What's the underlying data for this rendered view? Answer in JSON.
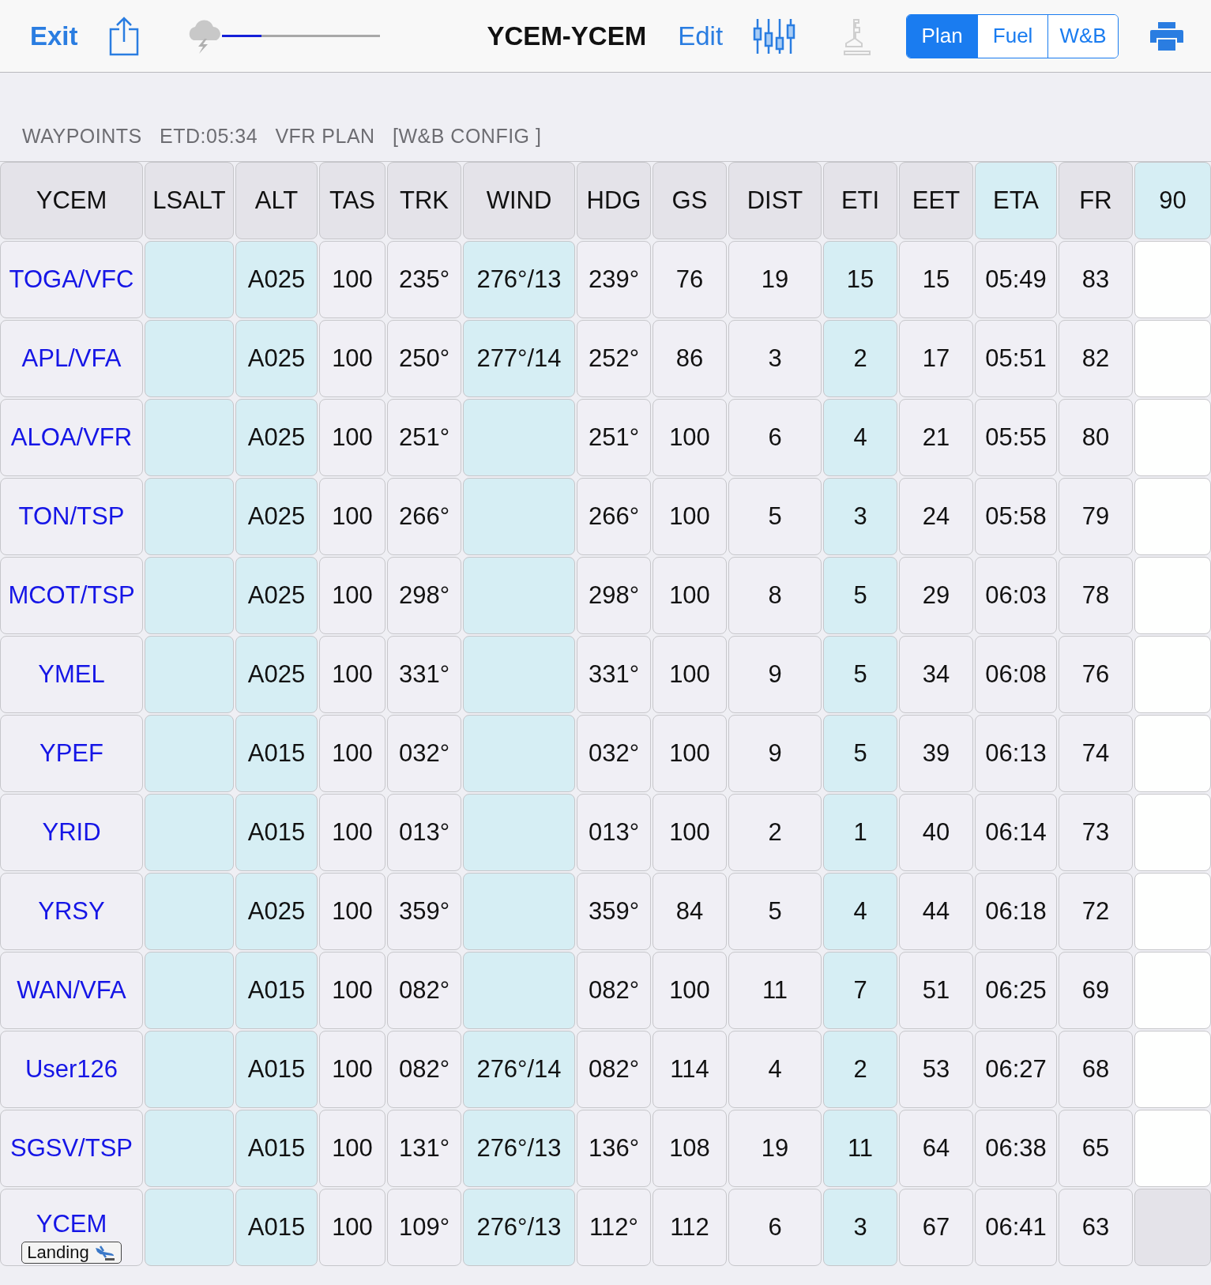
{
  "toolbar": {
    "exit": "Exit",
    "weather_slider": {
      "level": 0.25
    },
    "title": "YCEM-YCEM",
    "edit": "Edit",
    "profile_disabled": true,
    "segments": [
      {
        "label": "Plan",
        "selected": true
      },
      {
        "label": "Fuel",
        "selected": false
      },
      {
        "label": "W&B",
        "selected": false
      }
    ]
  },
  "subtitle": "WAYPOINTS   ETD:05:34   VFR PLAN   [W&B CONFIG ]",
  "table": {
    "columns": [
      {
        "label": "YCEM",
        "highlighted": false,
        "kind": "waypoint"
      },
      {
        "label": "LSALT",
        "highlighted": false,
        "kind": "input"
      },
      {
        "label": "ALT",
        "highlighted": false,
        "kind": "input"
      },
      {
        "label": "TAS",
        "highlighted": false,
        "kind": "computed"
      },
      {
        "label": "TRK",
        "highlighted": false,
        "kind": "computed"
      },
      {
        "label": "WIND",
        "highlighted": false,
        "kind": "input"
      },
      {
        "label": "HDG",
        "highlighted": false,
        "kind": "computed"
      },
      {
        "label": "GS",
        "highlighted": false,
        "kind": "computed"
      },
      {
        "label": "DIST",
        "highlighted": false,
        "kind": "computed"
      },
      {
        "label": "ETI",
        "highlighted": false,
        "kind": "input"
      },
      {
        "label": "EET",
        "highlighted": false,
        "kind": "computed"
      },
      {
        "label": "ETA",
        "highlighted": true,
        "kind": "computed"
      },
      {
        "label": "FR",
        "highlighted": false,
        "kind": "computed"
      },
      {
        "label": "90",
        "highlighted": true,
        "kind": "blank"
      }
    ],
    "rows": [
      {
        "kind": "leg",
        "cells": [
          "TOGA/VFC",
          "",
          "A025",
          "100",
          "235°",
          "276°/13",
          "239°",
          "76",
          "19",
          "15",
          "15",
          "05:49",
          "83",
          ""
        ]
      },
      {
        "kind": "leg",
        "cells": [
          "APL/VFA",
          "",
          "A025",
          "100",
          "250°",
          "277°/14",
          "252°",
          "86",
          "3",
          "2",
          "17",
          "05:51",
          "82",
          ""
        ]
      },
      {
        "kind": "leg",
        "cells": [
          "ALOA/VFR",
          "",
          "A025",
          "100",
          "251°",
          "",
          "251°",
          "100",
          "6",
          "4",
          "21",
          "05:55",
          "80",
          ""
        ]
      },
      {
        "kind": "leg",
        "cells": [
          "TON/TSP",
          "",
          "A025",
          "100",
          "266°",
          "",
          "266°",
          "100",
          "5",
          "3",
          "24",
          "05:58",
          "79",
          ""
        ]
      },
      {
        "kind": "leg",
        "cells": [
          "MCOT/TSP",
          "",
          "A025",
          "100",
          "298°",
          "",
          "298°",
          "100",
          "8",
          "5",
          "29",
          "06:03",
          "78",
          ""
        ]
      },
      {
        "kind": "leg",
        "cells": [
          "YMEL",
          "",
          "A025",
          "100",
          "331°",
          "",
          "331°",
          "100",
          "9",
          "5",
          "34",
          "06:08",
          "76",
          ""
        ]
      },
      {
        "kind": "leg",
        "cells": [
          "YPEF",
          "",
          "A015",
          "100",
          "032°",
          "",
          "032°",
          "100",
          "9",
          "5",
          "39",
          "06:13",
          "74",
          ""
        ]
      },
      {
        "kind": "leg",
        "cells": [
          "YRID",
          "",
          "A015",
          "100",
          "013°",
          "",
          "013°",
          "100",
          "2",
          "1",
          "40",
          "06:14",
          "73",
          ""
        ]
      },
      {
        "kind": "leg",
        "cells": [
          "YRSY",
          "",
          "A025",
          "100",
          "359°",
          "",
          "359°",
          "84",
          "5",
          "4",
          "44",
          "06:18",
          "72",
          ""
        ]
      },
      {
        "kind": "leg",
        "cells": [
          "WAN/VFA",
          "",
          "A015",
          "100",
          "082°",
          "",
          "082°",
          "100",
          "11",
          "7",
          "51",
          "06:25",
          "69",
          ""
        ]
      },
      {
        "kind": "leg",
        "cells": [
          "User126",
          "",
          "A015",
          "100",
          "082°",
          "276°/14",
          "082°",
          "114",
          "4",
          "2",
          "53",
          "06:27",
          "68",
          ""
        ]
      },
      {
        "kind": "leg",
        "cells": [
          "SGSV/TSP",
          "",
          "A015",
          "100",
          "131°",
          "276°/13",
          "136°",
          "108",
          "19",
          "11",
          "64",
          "06:38",
          "65",
          ""
        ]
      },
      {
        "kind": "landing",
        "badge": "Landing",
        "cells": [
          "YCEM",
          "",
          "A015",
          "100",
          "109°",
          "276°/13",
          "112°",
          "112",
          "6",
          "3",
          "67",
          "06:41",
          "63",
          ""
        ]
      }
    ]
  }
}
